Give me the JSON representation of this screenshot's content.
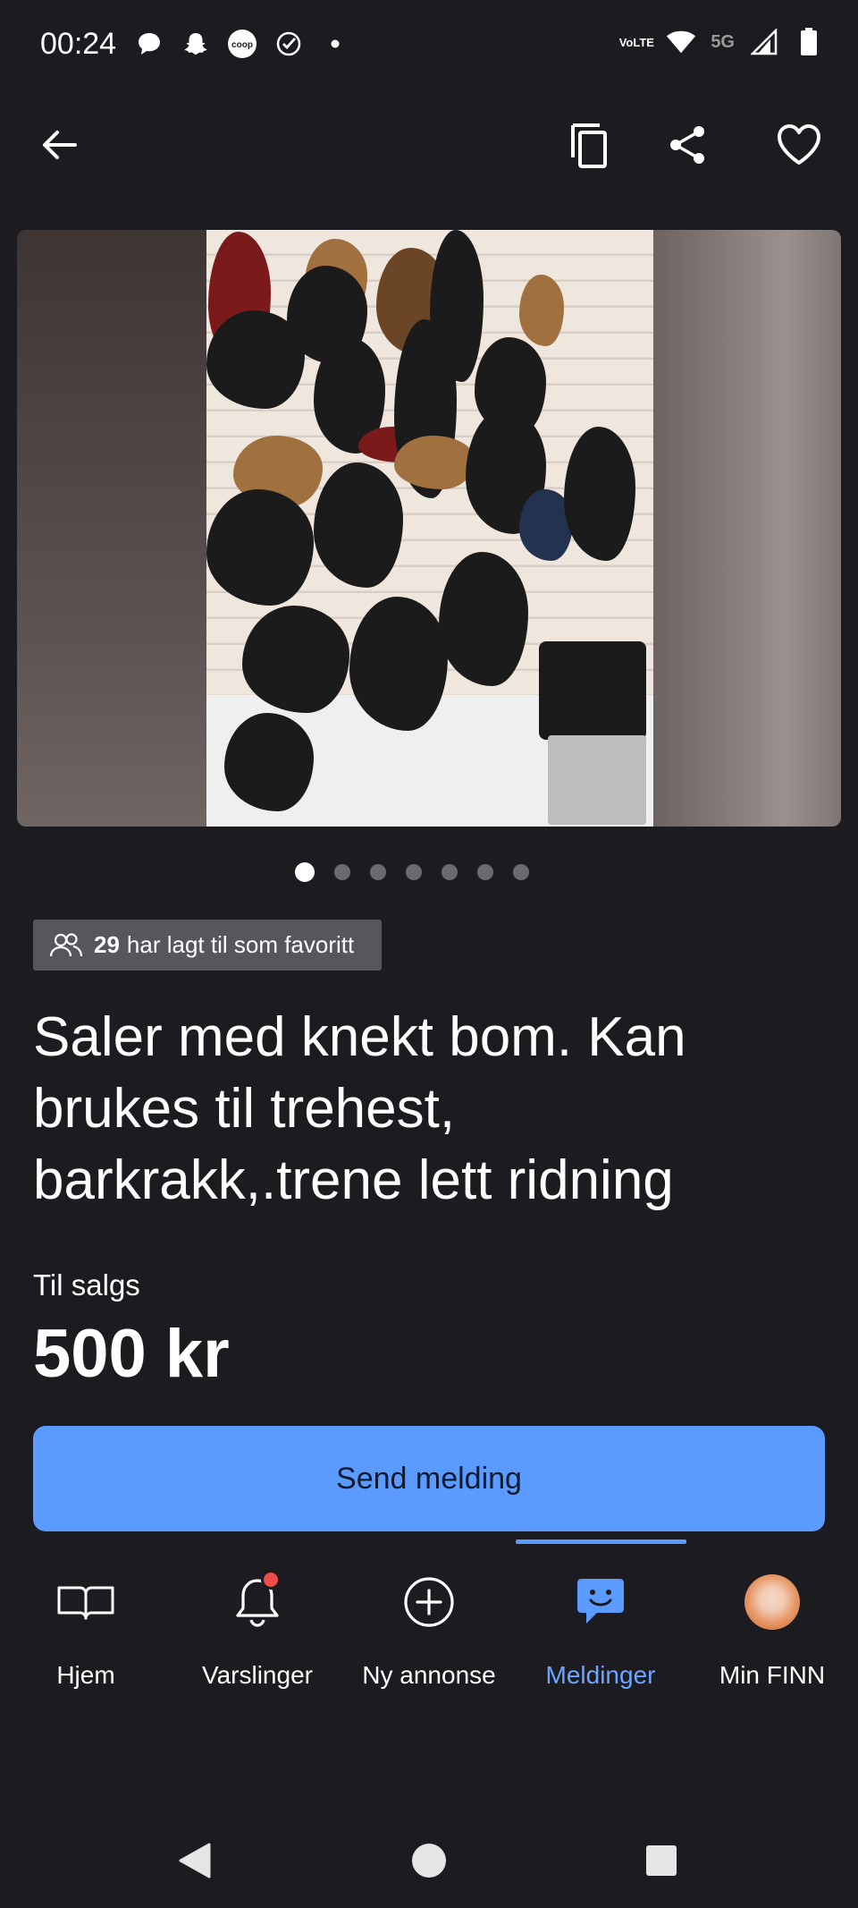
{
  "status_bar": {
    "time": "00:24",
    "left_icons": [
      "chat-bubble-icon",
      "snapchat-icon",
      "coop-icon",
      "check-circle-icon",
      "dot-icon"
    ],
    "coop_text": "coop",
    "lte_line1": "Vo",
    "lte_line2": "LTE",
    "network": "5G",
    "right_icons": [
      "volte-icon",
      "wifi-icon",
      "signal-icon",
      "battery-icon"
    ]
  },
  "app_bar": {
    "icons": [
      "back-arrow-icon",
      "copy-icon",
      "share-icon",
      "heart-icon"
    ]
  },
  "carousel": {
    "image_count": 7,
    "active_index": 0
  },
  "favorites": {
    "count": "29",
    "text": "har lagt til som favoritt",
    "icon": "people-icon"
  },
  "listing": {
    "title": "Saler med knekt bom. Kan brukes til trehest, barkrakk,.trene lett ridning",
    "sale_label": "Til salgs",
    "price": "500 kr"
  },
  "actions": {
    "send_message": "Send melding"
  },
  "bottom_nav": {
    "items": [
      {
        "label": "Hjem",
        "icon": "book-icon",
        "active": false
      },
      {
        "label": "Varslinger",
        "icon": "bell-icon",
        "active": false
      },
      {
        "label": "Ny annonse",
        "icon": "plus-circle-icon",
        "active": false
      },
      {
        "label": "Meldinger",
        "icon": "message-icon",
        "active": true
      },
      {
        "label": "Min FINN",
        "icon": "avatar",
        "active": false
      }
    ]
  },
  "system_nav": {
    "icons": [
      "back-triangle-icon",
      "home-circle-icon",
      "recents-square-icon"
    ]
  },
  "colors": {
    "background": "#1b1b20",
    "accent": "#5b9aff",
    "active_label": "#6ea5ff",
    "badge_bg": "#56575d",
    "notification": "#ef4b4b"
  }
}
